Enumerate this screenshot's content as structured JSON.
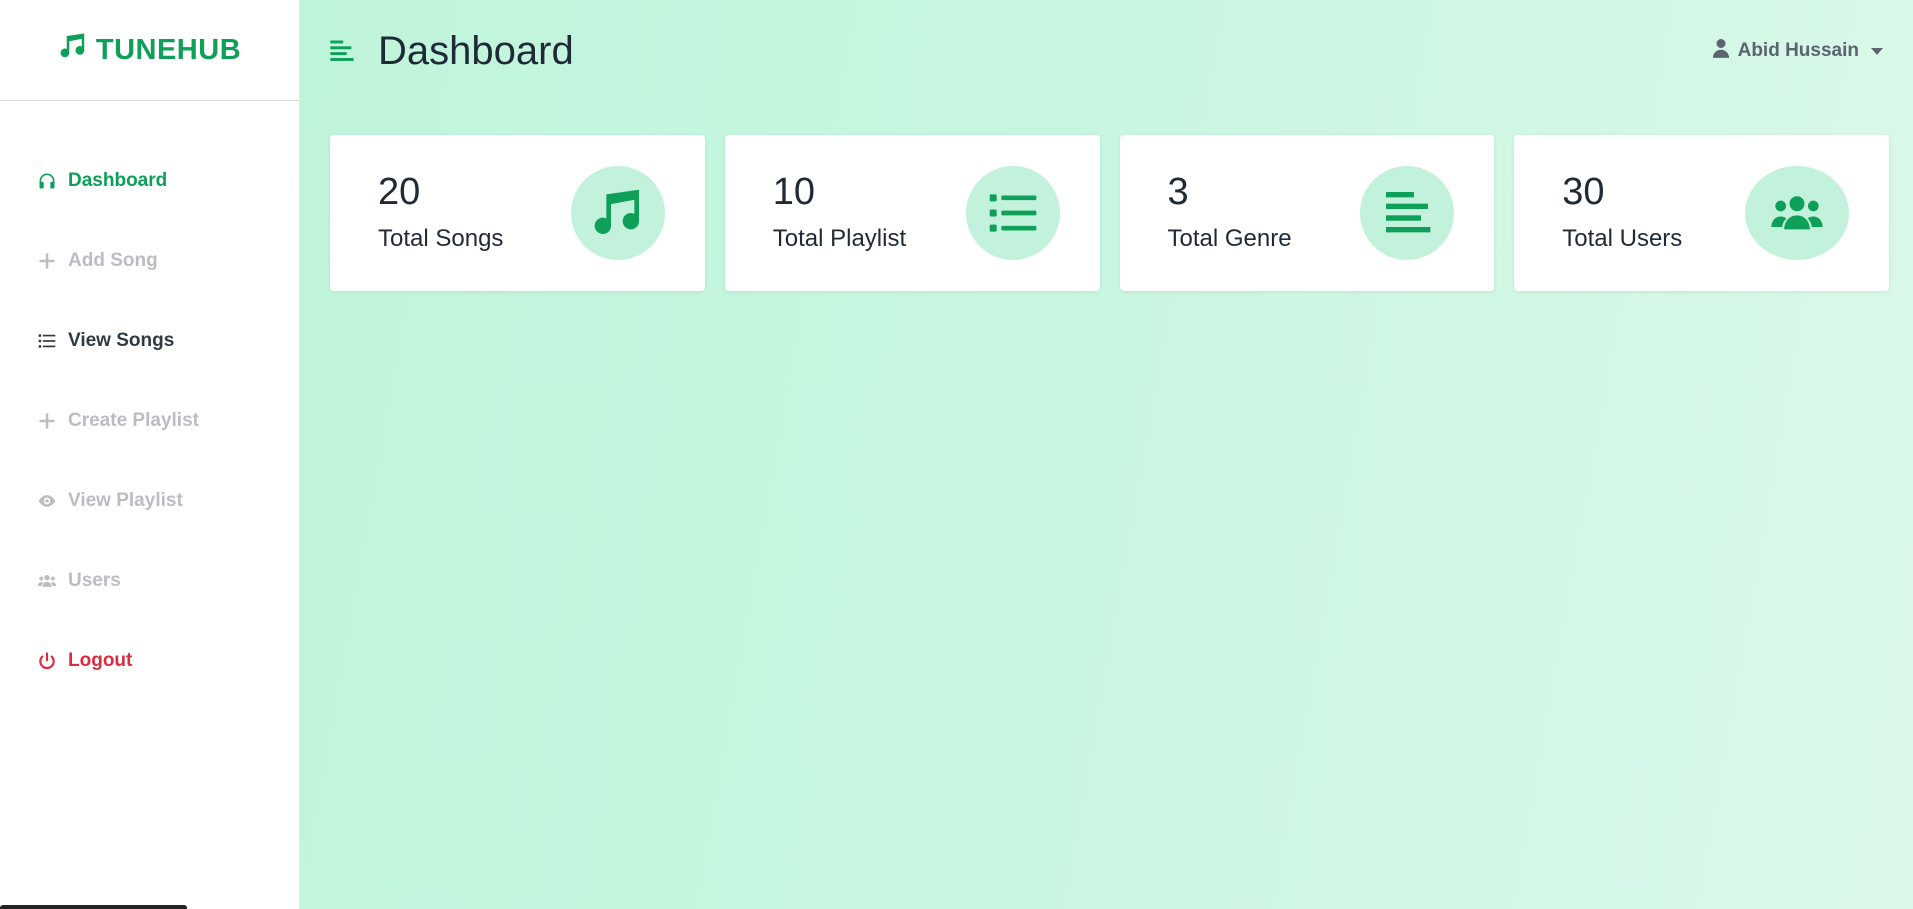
{
  "brand": {
    "name": "TUNEHUB",
    "icon": "music-note-icon",
    "color": "#0e9f58"
  },
  "sidebar": {
    "items": [
      {
        "label": "Dashboard",
        "icon": "headphones-icon",
        "state": "active"
      },
      {
        "label": "Add Song",
        "icon": "plus-icon",
        "state": "muted"
      },
      {
        "label": "View Songs",
        "icon": "list-icon",
        "state": "dark"
      },
      {
        "label": "Create Playlist",
        "icon": "plus-icon",
        "state": "muted"
      },
      {
        "label": "View Playlist",
        "icon": "eye-icon",
        "state": "muted"
      },
      {
        "label": "Users",
        "icon": "users-icon",
        "state": "muted"
      },
      {
        "label": "Logout",
        "icon": "power-icon",
        "state": "danger"
      }
    ]
  },
  "header": {
    "title": "Dashboard",
    "menu_icon": "align-left-icon",
    "user": {
      "name": "Abid Hussain",
      "icon": "user-icon"
    }
  },
  "stats": [
    {
      "value": "20",
      "label": "Total Songs",
      "icon": "music-note-icon"
    },
    {
      "value": "10",
      "label": "Total Playlist",
      "icon": "list-icon"
    },
    {
      "value": "3",
      "label": "Total Genre",
      "icon": "align-left-icon"
    },
    {
      "value": "30",
      "label": "Total Users",
      "icon": "users-icon"
    }
  ],
  "colors": {
    "accent": "#0e9f58",
    "danger": "#dc2d3f",
    "muted": "#b9bec3",
    "icon_bg": "#c2f1dc"
  }
}
